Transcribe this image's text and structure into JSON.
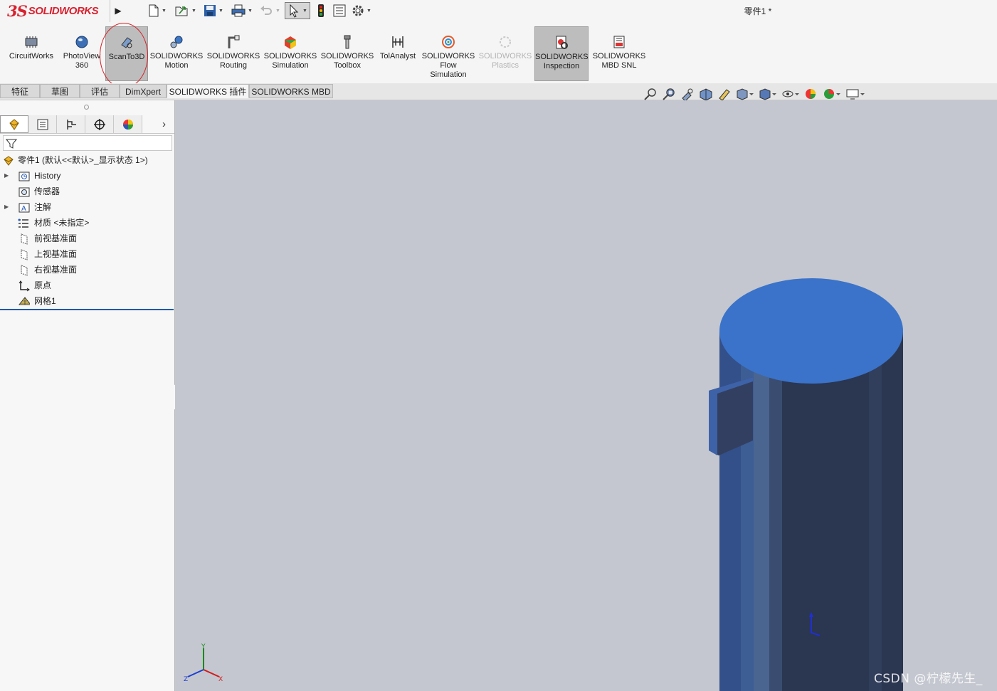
{
  "app": {
    "logo_ds": "3S",
    "logo_name": "SOLIDWORKS",
    "document_title": "零件1 *"
  },
  "quick_access": {
    "icons": [
      "new-document-icon",
      "open-folder-icon",
      "save-icon",
      "print-icon",
      "undo-icon",
      "select-arrow-icon",
      "rebuild-traffic-light-icon",
      "file-properties-icon",
      "options-gear-icon"
    ]
  },
  "command_manager": {
    "items": [
      {
        "label": "CircuitWorks",
        "icon": "circuitworks-icon"
      },
      {
        "label": "PhotoView\n360",
        "icon": "photoview-icon"
      },
      {
        "label": "ScanTo3D",
        "icon": "scanto3d-icon",
        "state": "selected"
      },
      {
        "label": "SOLIDWORKS\nMotion",
        "icon": "motion-icon"
      },
      {
        "label": "SOLIDWORKS\nRouting",
        "icon": "routing-icon"
      },
      {
        "label": "SOLIDWORKS\nSimulation",
        "icon": "simulation-icon"
      },
      {
        "label": "SOLIDWORKS\nToolbox",
        "icon": "toolbox-icon"
      },
      {
        "label": "TolAnalyst",
        "icon": "tolanalyst-icon"
      },
      {
        "label": "SOLIDWORKS\nFlow\nSimulation",
        "icon": "flow-simulation-icon"
      },
      {
        "label": "SOLIDWORKS\nPlastics",
        "icon": "plastics-icon",
        "state": "disabled"
      },
      {
        "label": "SOLIDWORKS\nInspection",
        "icon": "inspection-icon",
        "state": "selected"
      },
      {
        "label": "SOLIDWORKS\nMBD SNL",
        "icon": "mbd-snl-icon"
      }
    ]
  },
  "tabs": [
    {
      "label": "特征"
    },
    {
      "label": "草图"
    },
    {
      "label": "评估"
    },
    {
      "label": "DimXpert"
    },
    {
      "label": "SOLIDWORKS 插件",
      "active": true
    },
    {
      "label": "SOLIDWORKS MBD"
    }
  ],
  "feature_tree": {
    "panel_tabs": [
      "featuremanager-icon",
      "propertymanager-icon",
      "configurationmanager-icon",
      "dimxpertmanager-icon",
      "displaymanager-icon"
    ],
    "root": "零件1  (默认<<默认>_显示状态 1>)",
    "items": [
      {
        "label": "History",
        "icon": "history-folder-icon",
        "expandable": true
      },
      {
        "label": "传感器",
        "icon": "sensors-icon",
        "expandable": false
      },
      {
        "label": "注解",
        "icon": "annotations-icon",
        "expandable": true
      },
      {
        "label": "材质 <未指定>",
        "icon": "material-icon",
        "expandable": false
      },
      {
        "label": "前视基准面",
        "icon": "plane-icon",
        "expandable": false
      },
      {
        "label": "上视基准面",
        "icon": "plane-icon",
        "expandable": false
      },
      {
        "label": "右视基准面",
        "icon": "plane-icon",
        "expandable": false
      },
      {
        "label": "原点",
        "icon": "origin-icon",
        "expandable": false
      },
      {
        "label": "网格1",
        "icon": "mesh-icon",
        "expandable": false
      }
    ]
  },
  "viewport": {
    "headsup_icons": [
      "zoom-to-fit-icon",
      "zoom-area-icon",
      "previous-view-icon",
      "section-view-icon",
      "dynamic-annotation-icon",
      "view-orientation-icon",
      "display-style-icon",
      "hide-show-icon",
      "edit-appearance-icon",
      "apply-scene-icon",
      "view-settings-icon"
    ],
    "watermark": "CSDN @柠檬先生_",
    "colors": {
      "background": "#c4c7cf",
      "cylinder_top": "#3a73c9",
      "cylinder_body": "#2b3650"
    },
    "triad": {
      "x": "X",
      "y": "Y",
      "z": "Z"
    }
  }
}
